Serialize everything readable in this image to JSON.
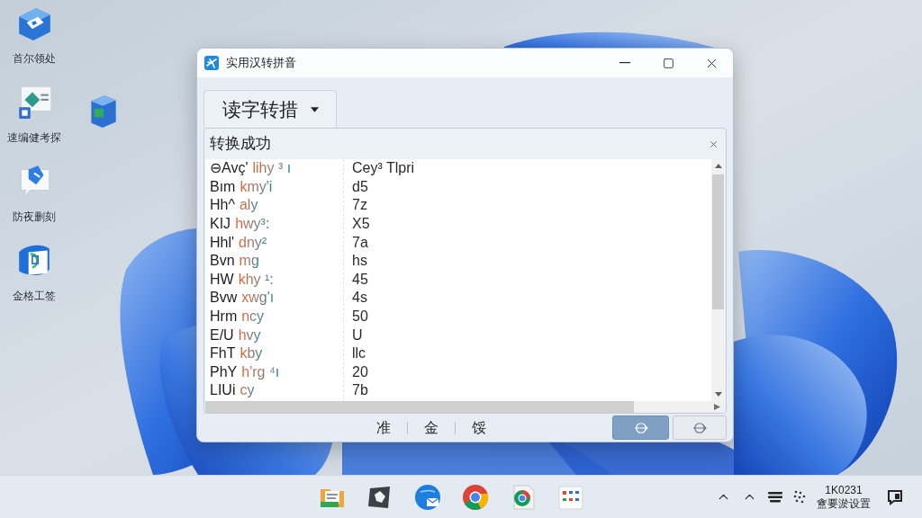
{
  "desktop_icons": [
    {
      "kind": "ticket",
      "label": "首尔领处"
    },
    {
      "kind": "slides",
      "label": "速编健考探"
    },
    {
      "kind": "cube"
    },
    {
      "kind": "chat",
      "label": "防夜删刻"
    },
    {
      "kind": "book",
      "label": "金格工签"
    }
  ],
  "window": {
    "title": "实用汉转拼音",
    "mode_dropdown": {
      "label": "读字转措"
    },
    "notice": {
      "text": "转换成功"
    },
    "list": {
      "rows": [
        {
          "word": "⊖Avç'",
          "syllable": "lihy ³ ı",
          "code": "Cey³ Tlpri"
        },
        {
          "word": "Bım",
          "syllable": "kmy'i",
          "code": "d5"
        },
        {
          "word": "Hh^",
          "syllable": "aly",
          "code": "7z"
        },
        {
          "word": "KIJ",
          "syllable": "hwy³:",
          "code": "X5"
        },
        {
          "word": "Hhl'",
          "syllable": "dny²",
          "code": "7a"
        },
        {
          "word": "Bvn",
          "syllable": "mg",
          "code": "hs"
        },
        {
          "word": "HW",
          "syllable": "khy ¹:",
          "code": "45"
        },
        {
          "word": "Bvw",
          "syllable": "xwg'ı",
          "code": "4s"
        },
        {
          "word": "Hrm",
          "syllable": "ncy",
          "code": "50"
        },
        {
          "word": "E/U",
          "syllable": "hvy",
          "code": "U"
        },
        {
          "word": "FhT",
          "syllable": "kby",
          "code": "llc"
        },
        {
          "word": "PhY",
          "syllable": "h'rg ⁴ı",
          "code": "20"
        },
        {
          "word": "LIUi",
          "syllable": "cy",
          "code": "7b"
        }
      ]
    },
    "footer_labels": [
      "准",
      "金",
      "馁"
    ],
    "footer_buttons": [
      {
        "kind": "primary"
      },
      {
        "kind": "default"
      }
    ]
  },
  "taskbar": {
    "apps": [
      {
        "kind": "files"
      },
      {
        "kind": "photos"
      },
      {
        "kind": "mail"
      },
      {
        "kind": "chrome"
      },
      {
        "kind": "chrome-doc"
      },
      {
        "kind": "calendar"
      }
    ],
    "tray": {
      "time": "1K0231",
      "date": "盦要淤设置"
    }
  }
}
